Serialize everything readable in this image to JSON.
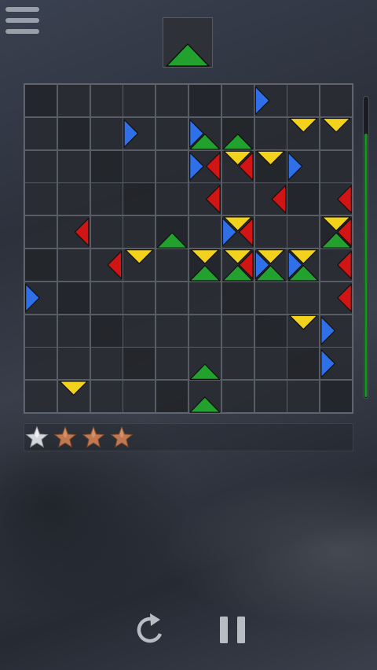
{
  "colors": {
    "red": "#d11414",
    "blue": "#2f6fe8",
    "green": "#22a12f",
    "yellow": "#f3d21c",
    "timer": "#1f8a2a",
    "star_silver": "#d4d6da",
    "star_bronze": "#c07850"
  },
  "menu": {
    "icon": "hamburger-menu-icon"
  },
  "next_piece": {
    "color": "green",
    "direction": "up"
  },
  "board": {
    "rows": 10,
    "cols": 10,
    "pieces": [
      {
        "r": 0,
        "c": 7,
        "color": "blue",
        "dir": "right"
      },
      {
        "r": 1,
        "c": 3,
        "color": "blue",
        "dir": "right"
      },
      {
        "r": 1,
        "c": 5,
        "color": "blue",
        "dir": "right"
      },
      {
        "r": 1,
        "c": 5,
        "color": "green",
        "dir": "up"
      },
      {
        "r": 1,
        "c": 6,
        "color": "green",
        "dir": "up"
      },
      {
        "r": 1,
        "c": 8,
        "color": "yellow",
        "dir": "down"
      },
      {
        "r": 1,
        "c": 9,
        "color": "yellow",
        "dir": "down"
      },
      {
        "r": 2,
        "c": 5,
        "color": "blue",
        "dir": "right"
      },
      {
        "r": 2,
        "c": 5,
        "color": "red",
        "dir": "left"
      },
      {
        "r": 2,
        "c": 6,
        "color": "yellow",
        "dir": "down"
      },
      {
        "r": 2,
        "c": 6,
        "color": "red",
        "dir": "left"
      },
      {
        "r": 2,
        "c": 7,
        "color": "yellow",
        "dir": "down"
      },
      {
        "r": 2,
        "c": 8,
        "color": "blue",
        "dir": "right"
      },
      {
        "r": 3,
        "c": 5,
        "color": "red",
        "dir": "left"
      },
      {
        "r": 3,
        "c": 7,
        "color": "red",
        "dir": "left"
      },
      {
        "r": 3,
        "c": 9,
        "color": "red",
        "dir": "left"
      },
      {
        "r": 4,
        "c": 1,
        "color": "red",
        "dir": "left"
      },
      {
        "r": 4,
        "c": 4,
        "color": "green",
        "dir": "up"
      },
      {
        "r": 4,
        "c": 6,
        "color": "yellow",
        "dir": "down"
      },
      {
        "r": 4,
        "c": 6,
        "color": "blue",
        "dir": "right"
      },
      {
        "r": 4,
        "c": 6,
        "color": "red",
        "dir": "left"
      },
      {
        "r": 4,
        "c": 9,
        "color": "yellow",
        "dir": "down"
      },
      {
        "r": 4,
        "c": 9,
        "color": "green",
        "dir": "up"
      },
      {
        "r": 4,
        "c": 9,
        "color": "red",
        "dir": "left"
      },
      {
        "r": 5,
        "c": 2,
        "color": "red",
        "dir": "left"
      },
      {
        "r": 5,
        "c": 3,
        "color": "yellow",
        "dir": "down"
      },
      {
        "r": 5,
        "c": 5,
        "color": "yellow",
        "dir": "down"
      },
      {
        "r": 5,
        "c": 5,
        "color": "green",
        "dir": "up"
      },
      {
        "r": 5,
        "c": 6,
        "color": "yellow",
        "dir": "down"
      },
      {
        "r": 5,
        "c": 6,
        "color": "green",
        "dir": "up"
      },
      {
        "r": 5,
        "c": 6,
        "color": "red",
        "dir": "left"
      },
      {
        "r": 5,
        "c": 7,
        "color": "yellow",
        "dir": "down"
      },
      {
        "r": 5,
        "c": 7,
        "color": "blue",
        "dir": "right"
      },
      {
        "r": 5,
        "c": 7,
        "color": "green",
        "dir": "up"
      },
      {
        "r": 5,
        "c": 8,
        "color": "yellow",
        "dir": "down"
      },
      {
        "r": 5,
        "c": 8,
        "color": "blue",
        "dir": "right"
      },
      {
        "r": 5,
        "c": 8,
        "color": "green",
        "dir": "up"
      },
      {
        "r": 5,
        "c": 9,
        "color": "red",
        "dir": "left"
      },
      {
        "r": 6,
        "c": 0,
        "color": "blue",
        "dir": "right"
      },
      {
        "r": 6,
        "c": 9,
        "color": "red",
        "dir": "left"
      },
      {
        "r": 7,
        "c": 8,
        "color": "yellow",
        "dir": "down"
      },
      {
        "r": 7,
        "c": 9,
        "color": "blue",
        "dir": "right"
      },
      {
        "r": 8,
        "c": 5,
        "color": "green",
        "dir": "up"
      },
      {
        "r": 8,
        "c": 9,
        "color": "blue",
        "dir": "right"
      },
      {
        "r": 9,
        "c": 1,
        "color": "yellow",
        "dir": "down"
      },
      {
        "r": 9,
        "c": 5,
        "color": "green",
        "dir": "up"
      }
    ]
  },
  "timer": {
    "remaining_fraction": 0.88
  },
  "stars": [
    {
      "kind": "silver"
    },
    {
      "kind": "bronze"
    },
    {
      "kind": "bronze"
    },
    {
      "kind": "bronze"
    }
  ],
  "controls": {
    "restart_icon": "restart-icon",
    "pause_icon": "pause-icon"
  }
}
